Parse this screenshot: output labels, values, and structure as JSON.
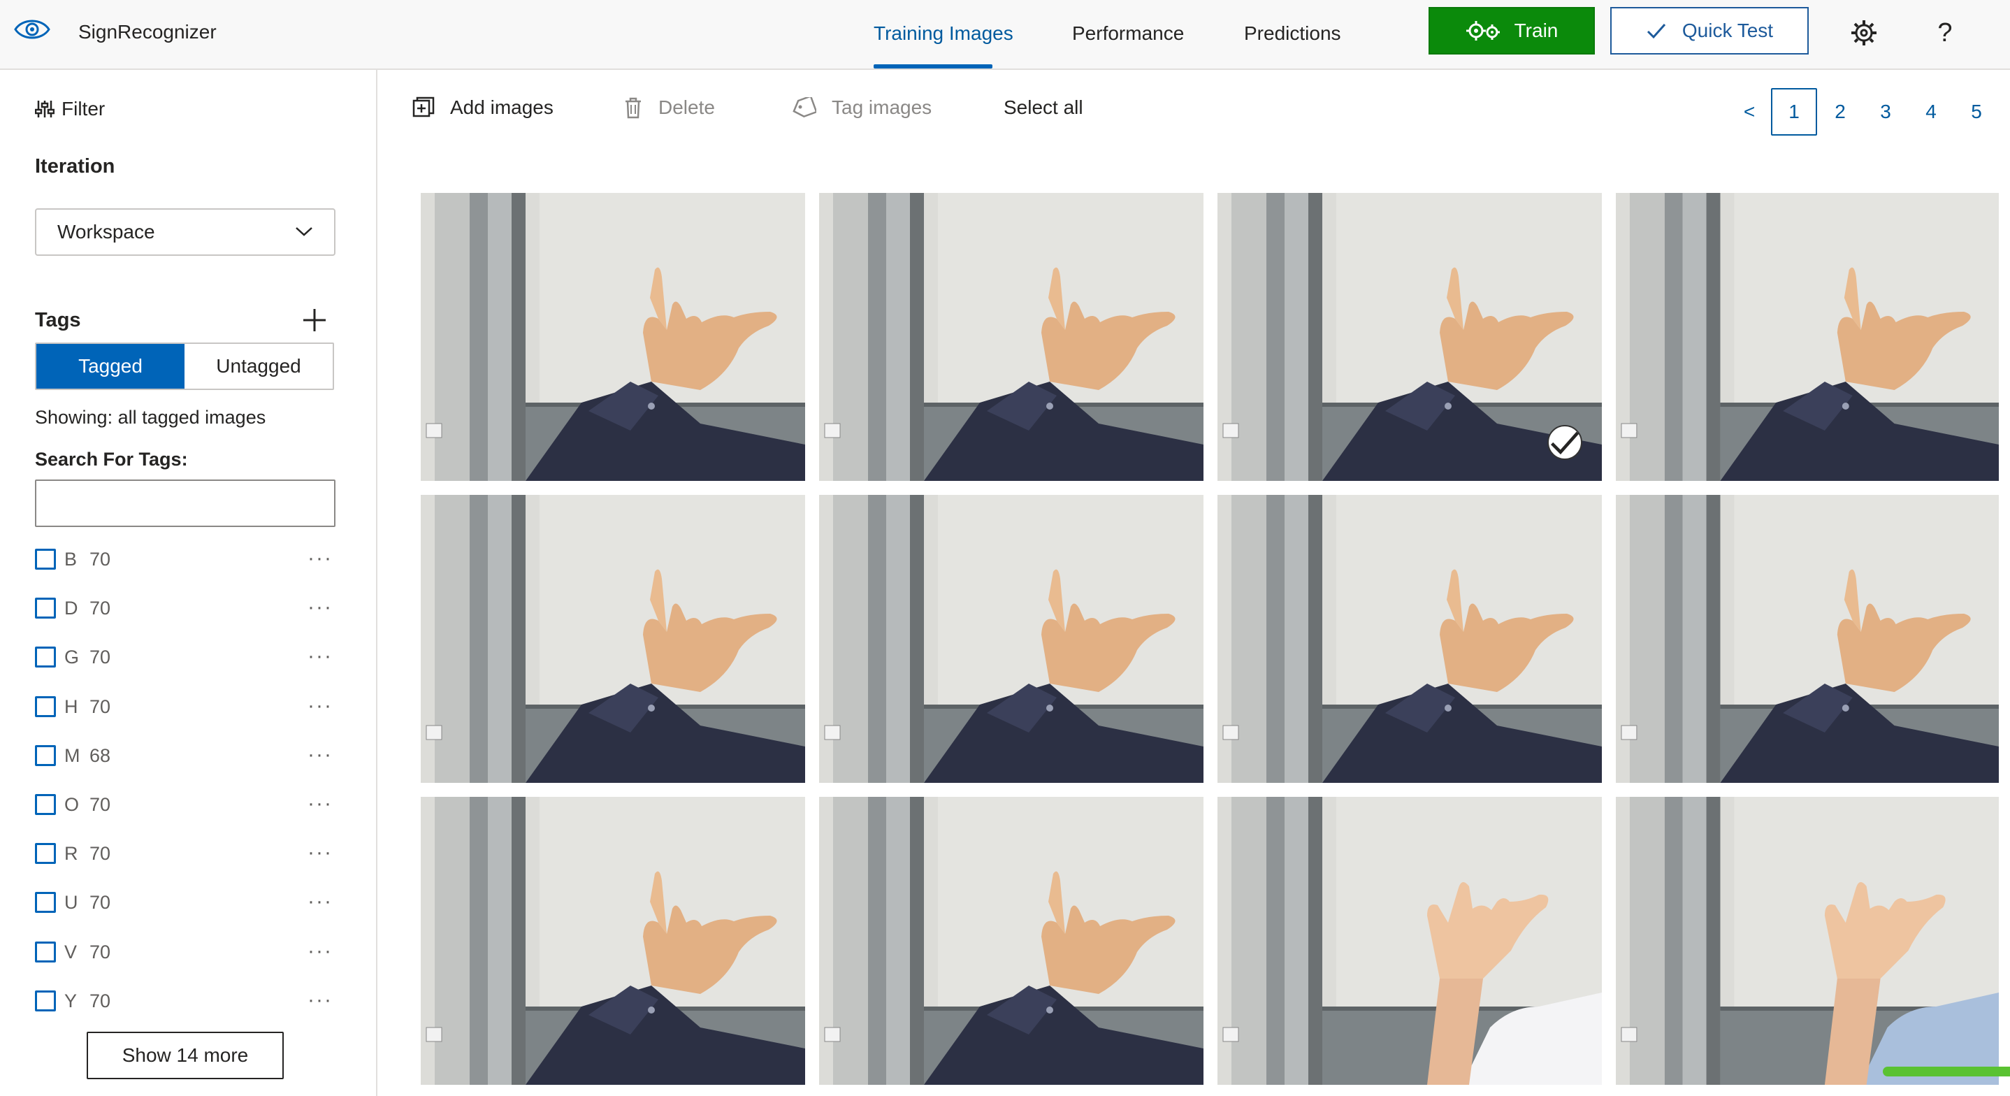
{
  "app": {
    "title": "SignRecognizer"
  },
  "nav": {
    "tabs": [
      {
        "label": "Training Images",
        "active": true
      },
      {
        "label": "Performance",
        "active": false
      },
      {
        "label": "Predictions",
        "active": false
      }
    ]
  },
  "header_actions": {
    "train_label": "Train",
    "quick_test_label": "Quick Test",
    "help_glyph": "?"
  },
  "sidebar": {
    "filter_label": "Filter",
    "iteration_heading": "Iteration",
    "iteration_value": "Workspace",
    "tags_heading": "Tags",
    "segment": {
      "tagged": "Tagged",
      "untagged": "Untagged",
      "selected": "tagged"
    },
    "showing_text": "Showing: all tagged images",
    "search_label": "Search For Tags:",
    "search_value": "",
    "tags": [
      {
        "name": "B",
        "count": "70",
        "checked": false
      },
      {
        "name": "D",
        "count": "70",
        "checked": false
      },
      {
        "name": "G",
        "count": "70",
        "checked": false
      },
      {
        "name": "H",
        "count": "70",
        "checked": false
      },
      {
        "name": "M",
        "count": "68",
        "checked": false
      },
      {
        "name": "O",
        "count": "70",
        "checked": false
      },
      {
        "name": "R",
        "count": "70",
        "checked": false
      },
      {
        "name": "U",
        "count": "70",
        "checked": false
      },
      {
        "name": "V",
        "count": "70",
        "checked": false
      },
      {
        "name": "Y",
        "count": "70",
        "checked": false
      }
    ],
    "more_glyph": "···",
    "show_more_label": "Show 14 more"
  },
  "toolbar": {
    "add_images": "Add images",
    "delete": "Delete",
    "tag_images": "Tag images",
    "select_all": "Select all"
  },
  "pagination": {
    "prev": "<",
    "pages": [
      "1",
      "2",
      "3",
      "4",
      "5"
    ],
    "current": "1"
  },
  "images": [
    {
      "variant": "sleeve",
      "selected": false
    },
    {
      "variant": "sleeve",
      "selected": false
    },
    {
      "variant": "sleeve",
      "selected": true
    },
    {
      "variant": "sleeve",
      "selected": false
    },
    {
      "variant": "sleeve",
      "selected": false
    },
    {
      "variant": "sleeve",
      "selected": false
    },
    {
      "variant": "sleeve",
      "selected": false
    },
    {
      "variant": "sleeve",
      "selected": false
    },
    {
      "variant": "sleeve",
      "selected": false
    },
    {
      "variant": "sleeve",
      "selected": false
    },
    {
      "variant": "bare-arm-white",
      "selected": false
    },
    {
      "variant": "bare-arm-blue",
      "selected": false
    }
  ],
  "colors": {
    "accent": "#0064b8",
    "train_green": "#0b8a0b",
    "nav_active": "#005a9e",
    "progress": "#5ac232"
  }
}
